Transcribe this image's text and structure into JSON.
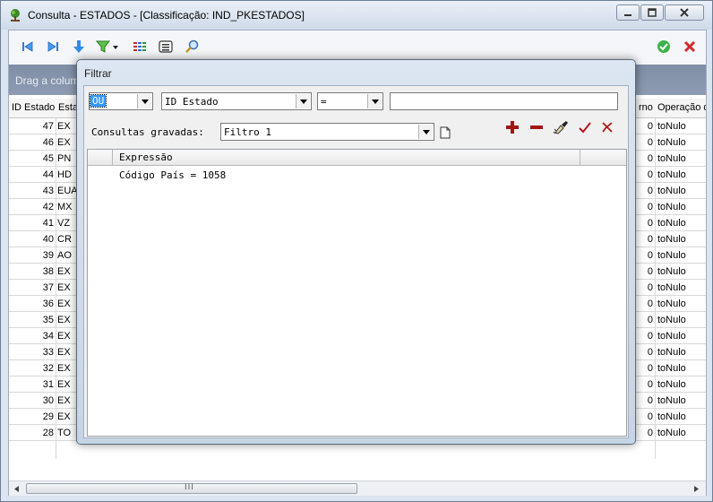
{
  "window": {
    "title": "Consulta - ESTADOS - [Classificação: IND_PKESTADOS]"
  },
  "toolbar": {
    "icons": [
      "first-record-icon",
      "last-record-icon",
      "download-icon",
      "filter-icon",
      "grid-columns-icon",
      "list-icon",
      "search-icon",
      "confirm-icon",
      "cancel-icon"
    ]
  },
  "grouping_panel": {
    "text": "Drag a column"
  },
  "grid": {
    "headers": {
      "id": "ID Estado",
      "sigla": "Esta",
      "interno": "rno",
      "operacao": "Operação d"
    },
    "rows": [
      {
        "id": "47",
        "sigla": "EX",
        "zero": "0",
        "op": "toNulo"
      },
      {
        "id": "46",
        "sigla": "EX",
        "zero": "0",
        "op": "toNulo"
      },
      {
        "id": "45",
        "sigla": "PN",
        "zero": "0",
        "op": "toNulo"
      },
      {
        "id": "44",
        "sigla": "HD",
        "zero": "0",
        "op": "toNulo"
      },
      {
        "id": "43",
        "sigla": "EUA",
        "zero": "0",
        "op": "toNulo"
      },
      {
        "id": "42",
        "sigla": "MX",
        "zero": "0",
        "op": "toNulo"
      },
      {
        "id": "41",
        "sigla": "VZ",
        "zero": "0",
        "op": "toNulo"
      },
      {
        "id": "40",
        "sigla": "CR",
        "zero": "0",
        "op": "toNulo"
      },
      {
        "id": "39",
        "sigla": "AO",
        "zero": "0",
        "op": "toNulo"
      },
      {
        "id": "38",
        "sigla": "EX",
        "zero": "0",
        "op": "toNulo"
      },
      {
        "id": "37",
        "sigla": "EX",
        "zero": "0",
        "op": "toNulo"
      },
      {
        "id": "36",
        "sigla": "EX",
        "zero": "0",
        "op": "toNulo"
      },
      {
        "id": "35",
        "sigla": "EX",
        "zero": "0",
        "op": "toNulo"
      },
      {
        "id": "34",
        "sigla": "EX",
        "zero": "0",
        "op": "toNulo"
      },
      {
        "id": "33",
        "sigla": "EX",
        "zero": "0",
        "op": "toNulo"
      },
      {
        "id": "32",
        "sigla": "EX",
        "zero": "0",
        "op": "toNulo"
      },
      {
        "id": "31",
        "sigla": "EX",
        "zero": "0",
        "op": "toNulo"
      },
      {
        "id": "30",
        "sigla": "EX",
        "zero": "0",
        "op": "toNulo"
      },
      {
        "id": "29",
        "sigla": "EX",
        "zero": "0",
        "op": "toNulo"
      },
      {
        "id": "28",
        "sigla": "TO",
        "zero": "0",
        "op": "toNulo"
      }
    ]
  },
  "hscroll": {
    "grip": "III"
  },
  "filter_dialog": {
    "title": "Filtrar",
    "logic_operator": "OU",
    "field": "ID Estado",
    "comparison": "=",
    "value": "",
    "saved_queries_label": "Consultas gravadas:",
    "saved_query": "Filtro 1",
    "expression_header": "Expressão",
    "expressions": [
      "Código País = 1058"
    ],
    "colors": {
      "add": "#a31515",
      "remove": "#a31515",
      "confirm": "#b01818",
      "cancel": "#b01818"
    }
  }
}
